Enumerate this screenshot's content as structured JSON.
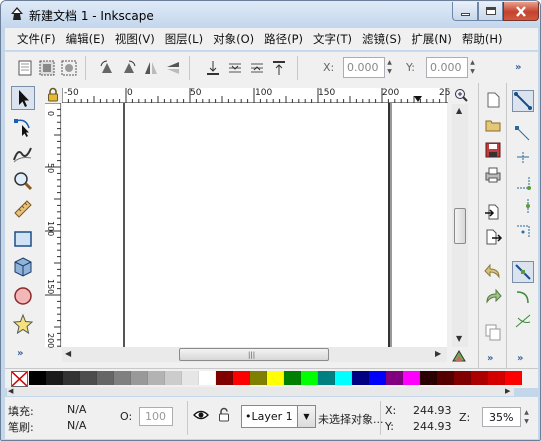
{
  "window": {
    "title": "新建文档 1 - Inkscape"
  },
  "menu": [
    "文件(F)",
    "编辑(E)",
    "视图(V)",
    "图层(L)",
    "对象(O)",
    "路径(P)",
    "文字(T)",
    "滤镜(S)",
    "扩展(N)",
    "帮助(H)"
  ],
  "toolbar": {
    "x_label": "X:",
    "x_value": "0.000",
    "y_label": "Y:",
    "y_value": "0.000",
    "more": "»"
  },
  "ruler": {
    "top_labels": [
      "-50",
      "0",
      "50",
      "100",
      "150",
      "200",
      "25"
    ],
    "left_labels": [
      "0",
      "50",
      "100",
      "150",
      "200"
    ]
  },
  "leftbar": {
    "more": "»"
  },
  "rightbar": {
    "more": "»"
  },
  "palette": {
    "colors": [
      "#000000",
      "#1a1a1a",
      "#333333",
      "#4d4d4d",
      "#666666",
      "#808080",
      "#999999",
      "#b3b3b3",
      "#cccccc",
      "#e6e6e6",
      "#ffffff",
      "#800000",
      "#ff0000",
      "#808000",
      "#ffff00",
      "#008000",
      "#00ff00",
      "#008080",
      "#00ffff",
      "#000080",
      "#0000ff",
      "#800080",
      "#ff00ff",
      "#2b0000",
      "#550000",
      "#800000",
      "#aa0000",
      "#d40000",
      "#ff0000"
    ]
  },
  "status": {
    "fill_label": "填充:",
    "fill_value": "N/A",
    "stroke_label": "笔刷:",
    "stroke_value": "N/A",
    "opacity_label": "O:",
    "opacity_value": "100",
    "layer": "•Layer 1",
    "message": "未选择对象...",
    "x_label": "X:",
    "x_value": "244.93",
    "y_label": "Y:",
    "y_value": "244.93",
    "zoom_label": "Z:",
    "zoom_value": "35%"
  }
}
